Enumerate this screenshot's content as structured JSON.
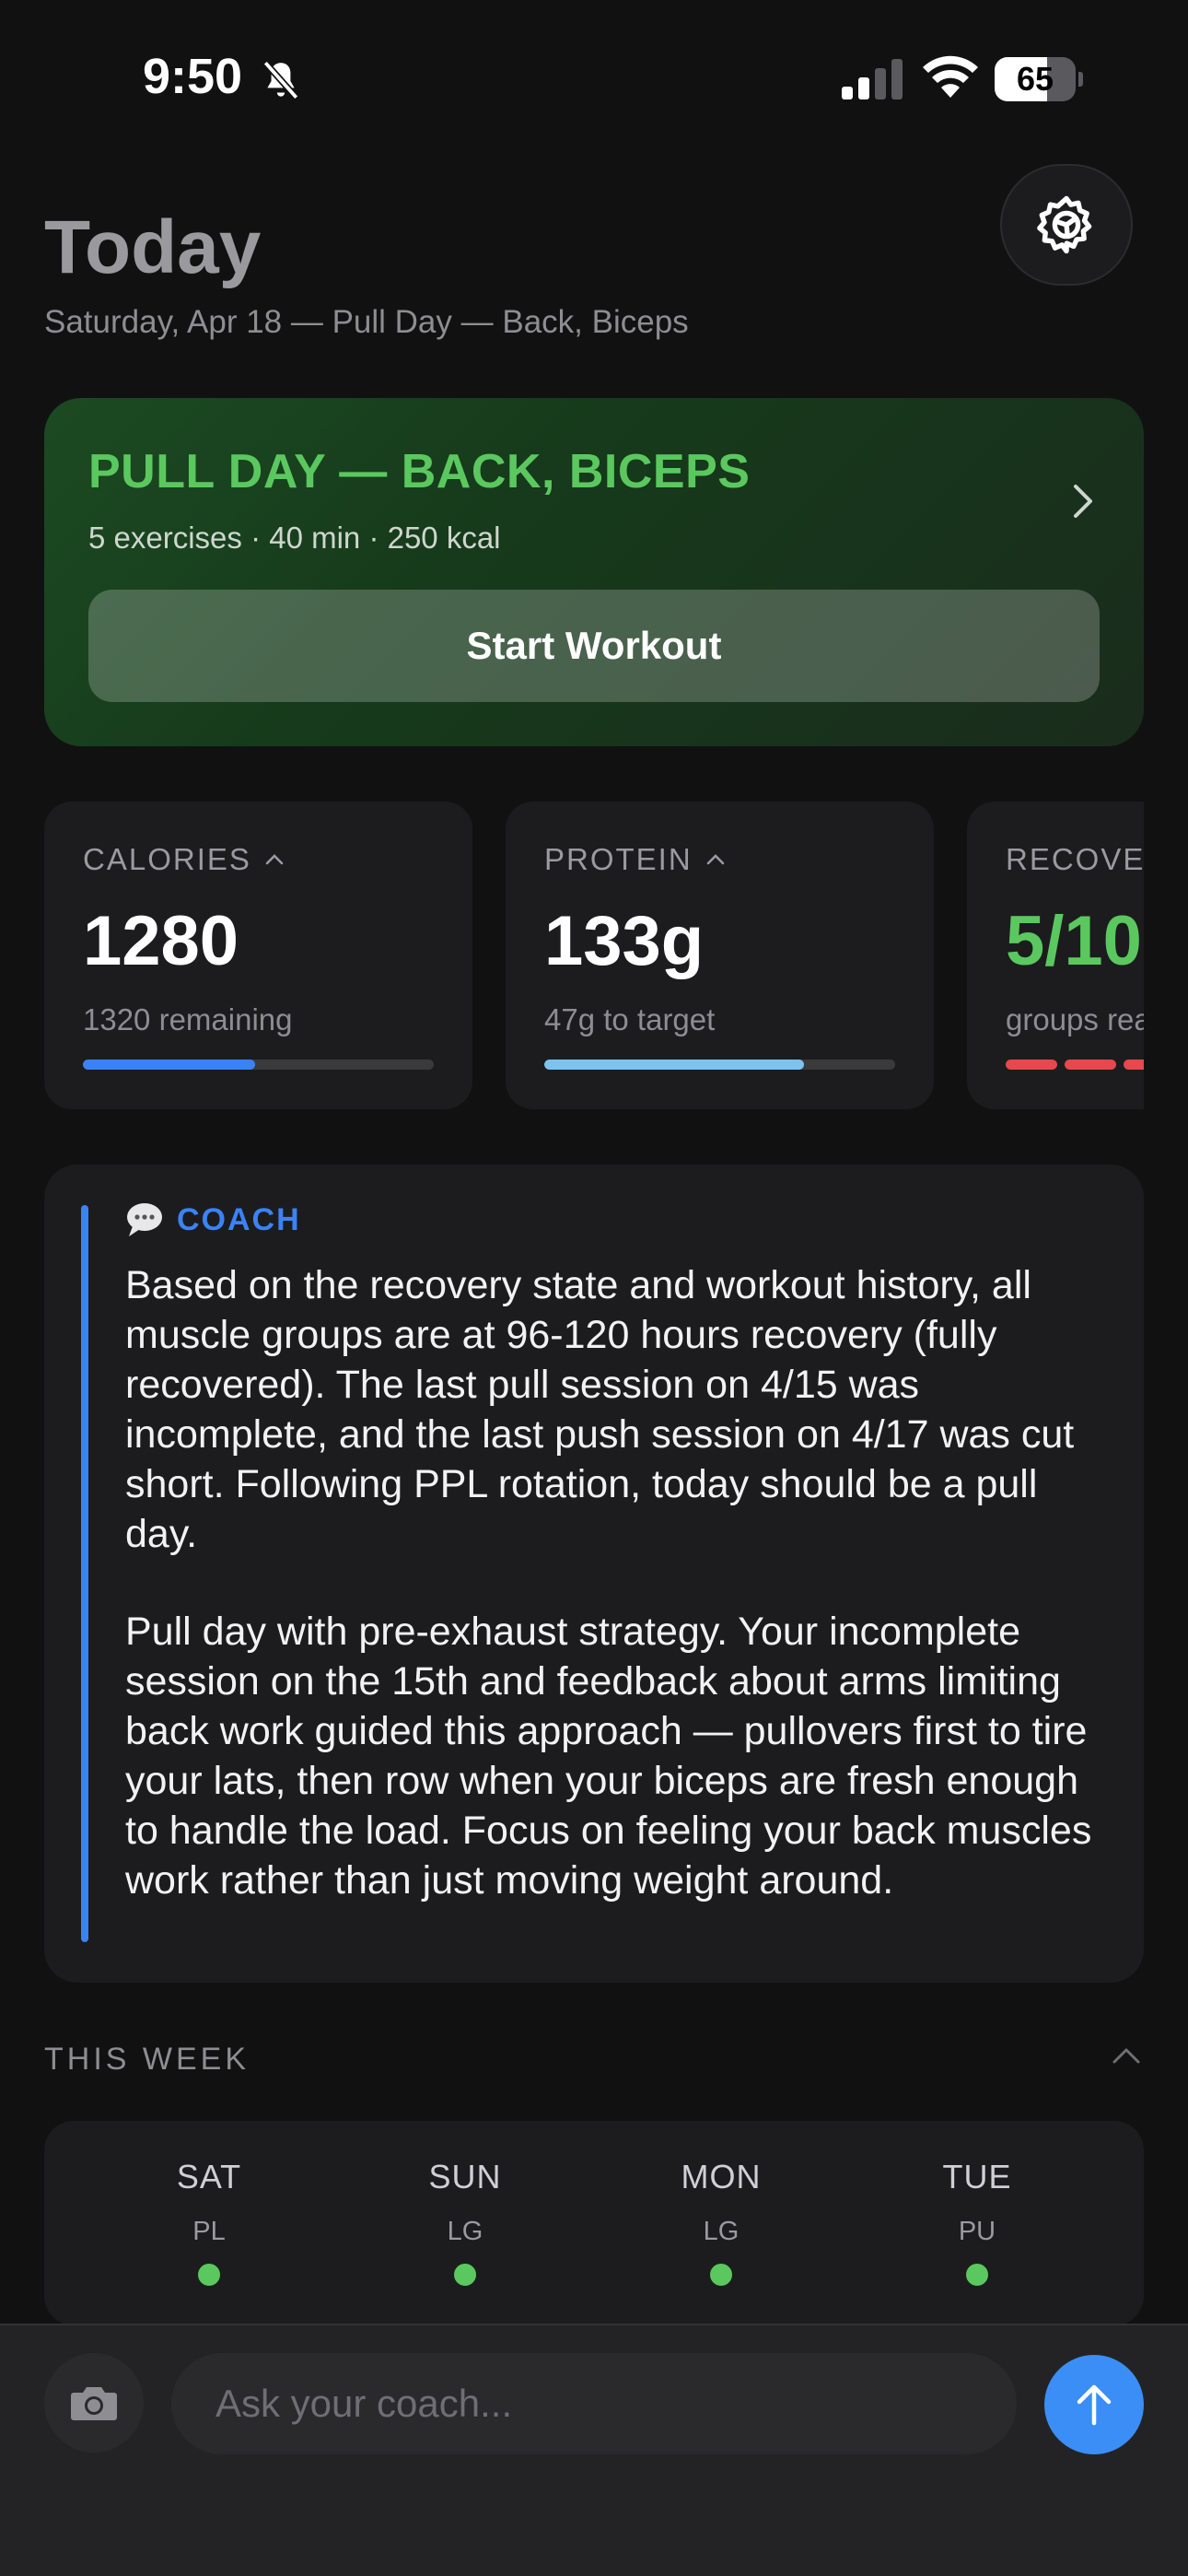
{
  "status_bar": {
    "time": "9:50",
    "battery_level": "65",
    "battery_fraction": 0.65,
    "icons": [
      "bell-slash-icon",
      "cellular-signal-icon",
      "wifi-icon",
      "battery-icon"
    ]
  },
  "header": {
    "title": "Today",
    "subtitle": "Saturday, Apr 18 — Pull Day — Back, Biceps",
    "settings_icon": "gear-icon"
  },
  "workout": {
    "title": "PULL DAY — BACK, BICEPS",
    "meta": "5 exercises · 40 min · 250 kcal",
    "start_label": "Start Workout",
    "accent": "#5bc85f"
  },
  "stats": [
    {
      "label": "CALORIES",
      "value": "1280",
      "sub": "1320 remaining",
      "progress": 0.49,
      "color": "#3b82f6"
    },
    {
      "label": "PROTEIN",
      "value": "133g",
      "sub": "47g to target",
      "progress": 0.74,
      "color": "#7cc4f0"
    },
    {
      "label": "RECOVERY",
      "value": "5/10",
      "sub": "groups ready",
      "progress": 0.5,
      "color": "#e5484d"
    }
  ],
  "coach": {
    "label": "COACH",
    "icon": "speech-bubble-icon",
    "paragraphs": [
      "Based on the recovery state and workout history, all muscle groups are at 96-120 hours recovery (fully recovered). The last pull session on 4/15 was incomplete, and the last push session on 4/17 was cut short. Following PPL rotation, today should be a pull day.",
      "Pull day with pre-exhaust strategy. Your incomplete session on the 15th and feedback about arms limiting back work guided this approach — pullovers first to tire your lats, then row when your biceps are fresh enough to handle the load. Focus on feeling your back muscles work rather than just moving weight around."
    ]
  },
  "week": {
    "label": "THIS WEEK",
    "days": [
      {
        "name": "SAT",
        "tag": "PL"
      },
      {
        "name": "SUN",
        "tag": "LG"
      },
      {
        "name": "MON",
        "tag": "LG"
      },
      {
        "name": "TUE",
        "tag": "PU"
      }
    ]
  },
  "composer": {
    "placeholder": "Ask your coach...",
    "camera_icon": "camera-icon",
    "send_icon": "arrow-up-icon",
    "send_color": "#3b8ef5"
  }
}
